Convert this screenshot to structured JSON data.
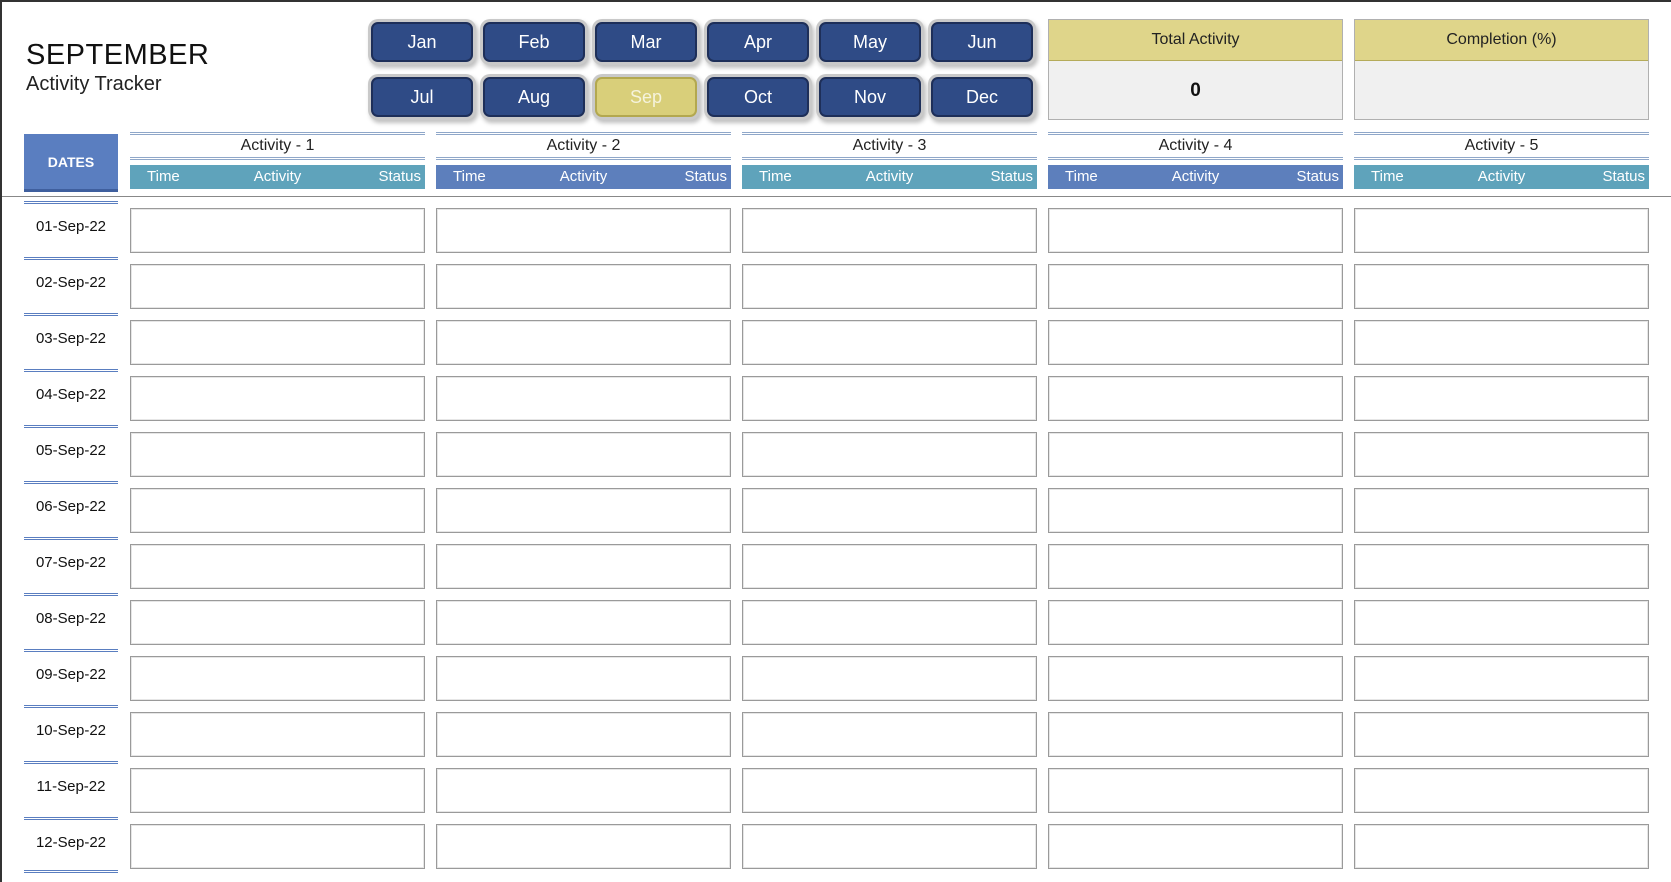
{
  "header": {
    "title": "SEPTEMBER",
    "subtitle": "Activity Tracker"
  },
  "months": {
    "row1": [
      "Jan",
      "Feb",
      "Mar",
      "Apr",
      "May",
      "Jun"
    ],
    "row2": [
      "Jul",
      "Aug",
      "Sep",
      "Oct",
      "Nov",
      "Dec"
    ],
    "selected": "Sep"
  },
  "kpis": {
    "total_activity": {
      "label": "Total Activity",
      "value": "0"
    },
    "completion": {
      "label": "Completion (%)",
      "value": ""
    }
  },
  "table": {
    "dates_header": "DATES",
    "activities": [
      "Activity - 1",
      "Activity - 2",
      "Activity - 3",
      "Activity - 4",
      "Activity - 5"
    ],
    "sub_headers": {
      "time": "Time",
      "activity": "Activity",
      "status": "Status"
    },
    "dates": [
      "01-Sep-22",
      "02-Sep-22",
      "03-Sep-22",
      "04-Sep-22",
      "05-Sep-22",
      "06-Sep-22",
      "07-Sep-22",
      "08-Sep-22",
      "09-Sep-22",
      "10-Sep-22",
      "11-Sep-22",
      "12-Sep-22"
    ]
  },
  "colors": {
    "month_button": "#2f4b86",
    "month_button_selected": "#d9cf7a",
    "kpi_header": "#dfd58a",
    "dates_header": "#5a7ec0",
    "subheader_teal": "#5fa3bb",
    "subheader_blue": "#5d7fbc"
  }
}
